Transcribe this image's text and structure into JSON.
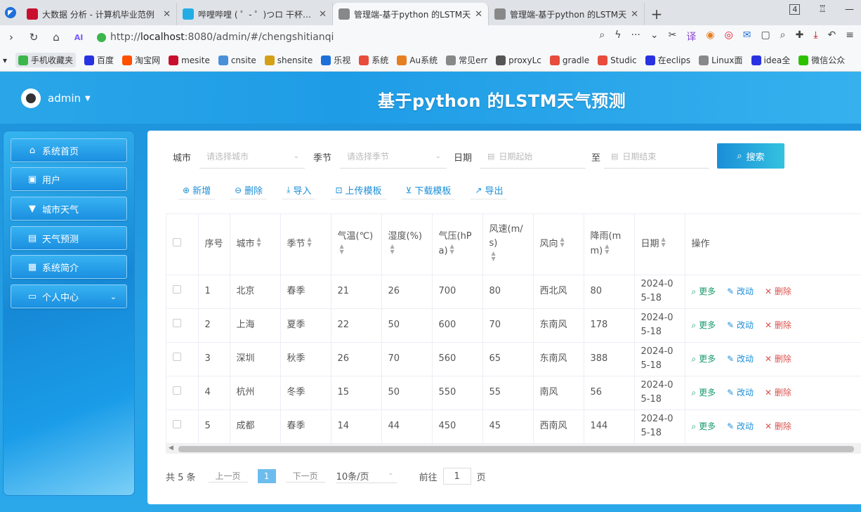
{
  "browser": {
    "tabs": [
      {
        "title": "大数据 分析 - 计算机毕业范例",
        "fav_color": "#c8102e",
        "active": false
      },
      {
        "title": "哔哩哔哩 ( ゜- ゜)つロ 干杯~-b",
        "fav_color": "#23ade5",
        "active": false
      },
      {
        "title": "管理端-基于python 的LSTM天",
        "fav_color": "#777777",
        "active": true
      },
      {
        "title": "管理端-基于python 的LSTM天",
        "fav_color": "#777777",
        "active": false
      }
    ],
    "tab_count": "4",
    "url_scheme": "http://",
    "url_host": "localhost",
    "url_rest": ":8080/admin/#/chengshitianqi",
    "bookmarks": [
      {
        "label": "手机收藏夹",
        "color": "#3cb54a"
      },
      {
        "label": "百度",
        "color": "#2932e1"
      },
      {
        "label": "淘宝网",
        "color": "#ff5000"
      },
      {
        "label": "mesite",
        "color": "#c8102e"
      },
      {
        "label": "cnsite",
        "color": "#4a90d9"
      },
      {
        "label": "shensite",
        "color": "#d4a017"
      },
      {
        "label": "乐视",
        "color": "#1e6fd9"
      },
      {
        "label": "系统",
        "color": "#e74c3c"
      },
      {
        "label": "Au系统",
        "color": "#e67e22"
      },
      {
        "label": "常见err",
        "color": "#888888"
      },
      {
        "label": "proxyLc",
        "color": "#555555"
      },
      {
        "label": "gradle",
        "color": "#e74c3c"
      },
      {
        "label": "Studic",
        "color": "#e74c3c"
      },
      {
        "label": "在eclips",
        "color": "#2932e1"
      },
      {
        "label": "Linux面",
        "color": "#888888"
      },
      {
        "label": "idea全",
        "color": "#2932e1"
      },
      {
        "label": "微信公众",
        "color": "#2dc100"
      }
    ]
  },
  "header": {
    "username": "admin",
    "title": "基于python 的LSTM天气预测"
  },
  "sidebar": {
    "items": [
      {
        "label": "系统首页",
        "icon": "⌂"
      },
      {
        "label": "用户",
        "icon": "▣"
      },
      {
        "label": "城市天气",
        "icon": "▼"
      },
      {
        "label": "天气预测",
        "icon": "▤"
      },
      {
        "label": "系统简介",
        "icon": "▦"
      },
      {
        "label": "个人中心",
        "icon": "▭",
        "arrow": "⌄"
      }
    ]
  },
  "search": {
    "city_label": "城市",
    "city_placeholder": "请选择城市",
    "season_label": "季节",
    "season_placeholder": "请选择季节",
    "date_label": "日期",
    "date_start_placeholder": "日期起始",
    "to_label": "至",
    "date_end_placeholder": "日期结束",
    "search_button": "搜索"
  },
  "actions": {
    "add": "新增",
    "delete": "删除",
    "import": "导入",
    "upload_template": "上传模板",
    "download_template": "下载模板",
    "export": "导出"
  },
  "table": {
    "headers": [
      "序号",
      "城市",
      "季节",
      "气温(℃)",
      "湿度(%)",
      "气压(hPa)",
      "风速(m/s)",
      "风向",
      "降雨(mm)",
      "日期",
      "操作"
    ],
    "rows": [
      {
        "no": "1",
        "city": "北京",
        "season": "春季",
        "temp": "21",
        "humidity": "26",
        "pressure": "700",
        "wind_speed": "80",
        "wind_dir": "西北风",
        "rain": "80",
        "date": "2024-05-18"
      },
      {
        "no": "2",
        "city": "上海",
        "season": "夏季",
        "temp": "22",
        "humidity": "50",
        "pressure": "600",
        "wind_speed": "70",
        "wind_dir": "东南风",
        "rain": "178",
        "date": "2024-05-18"
      },
      {
        "no": "3",
        "city": "深圳",
        "season": "秋季",
        "temp": "26",
        "humidity": "70",
        "pressure": "560",
        "wind_speed": "65",
        "wind_dir": "东南风",
        "rain": "388",
        "date": "2024-05-18"
      },
      {
        "no": "4",
        "city": "杭州",
        "season": "冬季",
        "temp": "15",
        "humidity": "50",
        "pressure": "550",
        "wind_speed": "55",
        "wind_dir": "南风",
        "rain": "56",
        "date": "2024-05-18"
      },
      {
        "no": "5",
        "city": "成都",
        "season": "春季",
        "temp": "14",
        "humidity": "44",
        "pressure": "450",
        "wind_speed": "45",
        "wind_dir": "西南风",
        "rain": "144",
        "date": "2024-05-18"
      }
    ],
    "op_more": "更多",
    "op_edit": "改动",
    "op_delete": "删除"
  },
  "pagination": {
    "total": "共 5 条",
    "prev": "上一页",
    "current": "1",
    "next": "下一页",
    "page_size": "10条/页",
    "goto_label": "前往",
    "goto_value": "1",
    "page_suffix": "页"
  }
}
